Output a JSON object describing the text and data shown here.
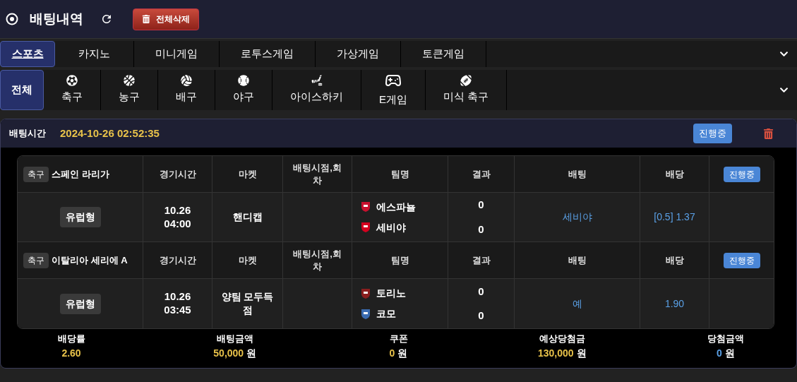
{
  "header": {
    "title": "배팅내역",
    "delete_all": "전체삭제"
  },
  "main_tabs": [
    {
      "label": "스포츠",
      "selected": true
    },
    {
      "label": "카지노",
      "selected": false
    },
    {
      "label": "미니게임",
      "selected": false
    },
    {
      "label": "로투스게임",
      "selected": false
    },
    {
      "label": "가상게임",
      "selected": false
    },
    {
      "label": "토큰게임",
      "selected": false
    }
  ],
  "sport_tabs": [
    {
      "label": "전체",
      "kind": "all",
      "selected": true
    },
    {
      "label": "축구",
      "kind": "soccer",
      "selected": false
    },
    {
      "label": "농구",
      "kind": "basketball",
      "selected": false
    },
    {
      "label": "배구",
      "kind": "volleyball",
      "selected": false
    },
    {
      "label": "야구",
      "kind": "baseball",
      "selected": false
    },
    {
      "label": "아이스하키",
      "kind": "hockey",
      "selected": false
    },
    {
      "label": "E게임",
      "kind": "esports",
      "selected": false
    },
    {
      "label": "미식 축구",
      "kind": "football",
      "selected": false
    }
  ],
  "bet": {
    "time_label": "배팅시간",
    "time": "2024-10-26 02:52:35",
    "status": "진행중",
    "games": [
      {
        "sport": "축구",
        "league": "스페인 라리가",
        "columns": [
          "경기시간",
          "마켓",
          "배팅시점,회차",
          "팀명",
          "결과",
          "배팅",
          "배당"
        ],
        "status": "진행중",
        "type": "유럽형",
        "match_time": "10.26 04:00",
        "market": "핸디캡",
        "teams": [
          {
            "name": "에스파뇰",
            "score": "0",
            "color": "#c8102e"
          },
          {
            "name": "세비야",
            "score": "0",
            "color": "#d4001f"
          }
        ],
        "pick": "세비야",
        "odds": "[0.5] 1.37"
      },
      {
        "sport": "축구",
        "league": "이탈리아 세리에 A",
        "columns": [
          "경기시간",
          "마켓",
          "배팅시점,회차",
          "팀명",
          "결과",
          "배팅",
          "배당"
        ],
        "status": "진행중",
        "type": "유럽형",
        "match_time": "10.26 03:45",
        "market": "양팀 모두득점",
        "teams": [
          {
            "name": "토리노",
            "score": "0",
            "color": "#8a1e1e"
          },
          {
            "name": "코모",
            "score": "0",
            "color": "#3a6bb0"
          }
        ],
        "pick": "예",
        "odds": "1.90"
      }
    ],
    "summary": [
      {
        "label": "배당률",
        "value": "2.60",
        "color": "#e8c24a"
      },
      {
        "label": "배팅금액",
        "value": "50,000",
        "unit": "원",
        "color": "#e8c24a"
      },
      {
        "label": "쿠폰",
        "value": "0",
        "unit": "원",
        "color": "#e8c24a"
      },
      {
        "label": "예상당첨금",
        "value": "130,000",
        "unit": "원",
        "color": "#e8c24a"
      },
      {
        "label": "당첨금액",
        "value": "0",
        "unit": "원",
        "color": "#5aa0e6"
      }
    ]
  }
}
